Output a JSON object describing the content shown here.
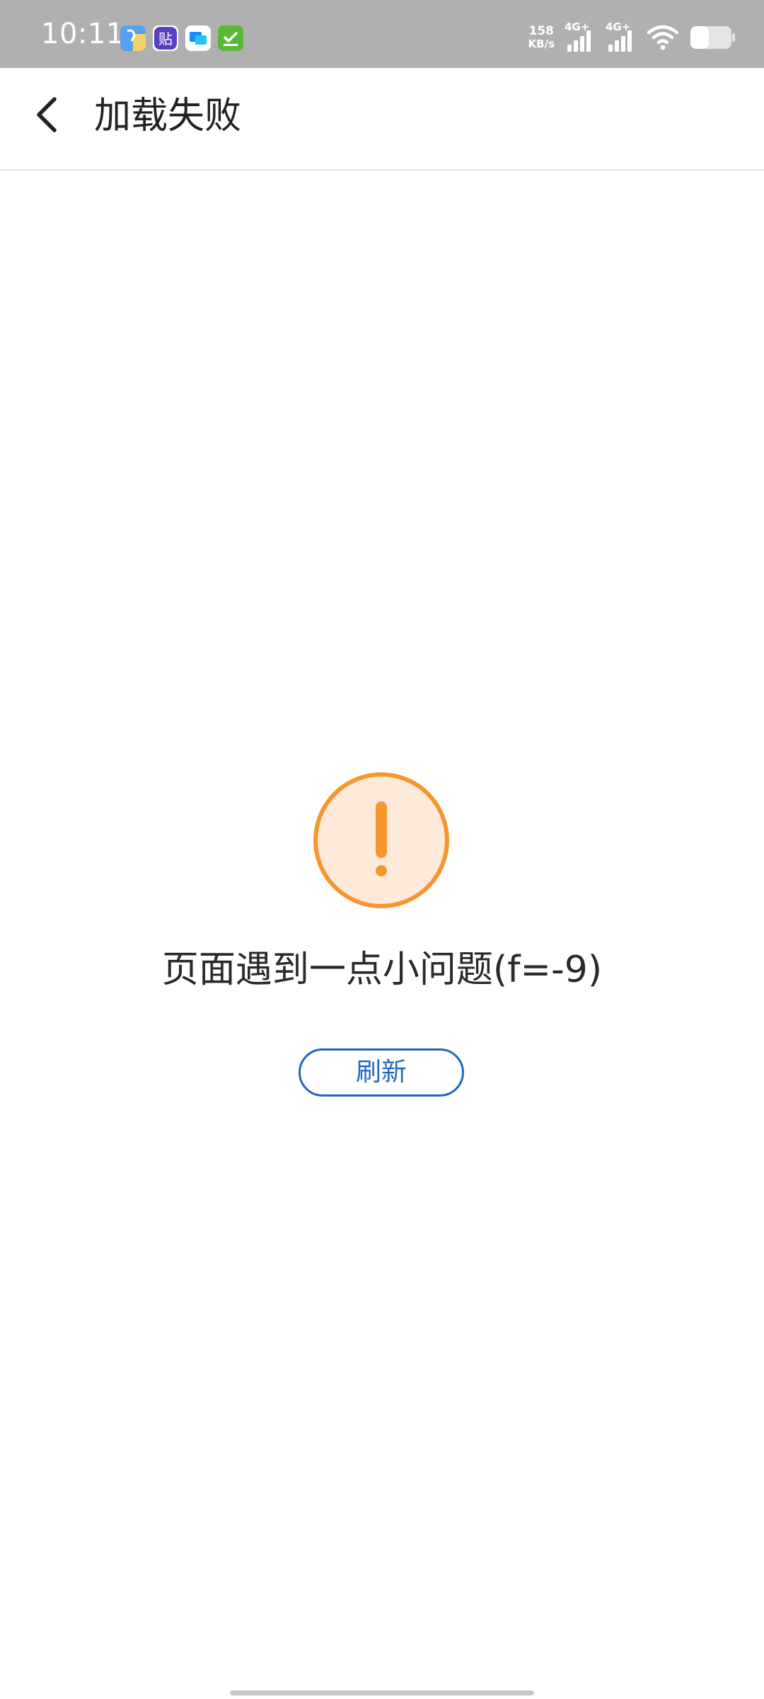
{
  "status_bar": {
    "time": "10:11",
    "net_speed_value": "158",
    "net_speed_unit": "KB/s",
    "sim1_label": "4G+",
    "sim2_label": "4G+",
    "notification_icons": [
      "location-app-icon",
      "tieba-app-icon",
      "chat-app-icon",
      "task-check-app-icon"
    ],
    "status_icons": [
      "signal-icon",
      "signal-icon",
      "wifi-icon",
      "battery-icon"
    ]
  },
  "toolbar": {
    "title": "加载失败",
    "back_icon": "back-arrow-icon"
  },
  "error": {
    "icon": "warning-exclamation-icon",
    "message": "页面遇到一点小问题(f=-9)",
    "refresh_label": "刷新"
  },
  "colors": {
    "status_bar_bg": "#b0b0b0",
    "accent_blue": "#1f66c4",
    "warning_orange": "#f7962e",
    "warning_fill": "#fdeadb"
  }
}
